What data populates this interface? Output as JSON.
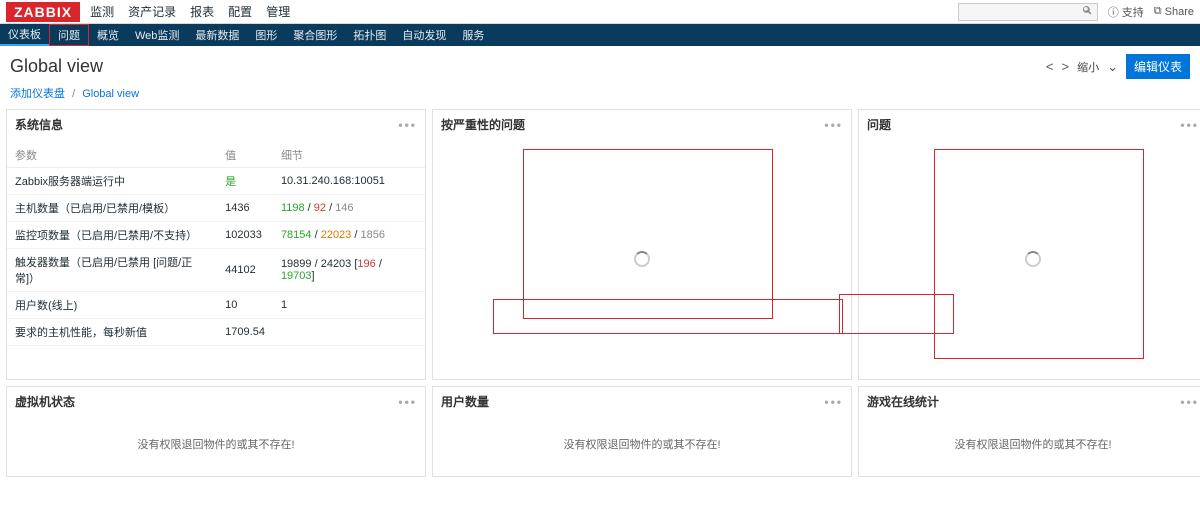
{
  "logo": "ZABBIX",
  "topmenu": [
    "监测",
    "资产记录",
    "报表",
    "配置",
    "管理"
  ],
  "support": "支持",
  "share": "Share",
  "subnav": [
    "仪表板",
    "问题",
    "概览",
    "Web监测",
    "最新数据",
    "图形",
    "聚合图形",
    "拓扑图",
    "自动发现",
    "服务"
  ],
  "page_title": "Global view",
  "edit_btn": "编辑仪表",
  "zoom_label": "缩小",
  "breadcrumb": {
    "a": "添加仪表盘",
    "b": "Global view"
  },
  "w_sysinfo": {
    "title": "系统信息",
    "cols": [
      "参数",
      "值",
      "细节"
    ],
    "rows": [
      {
        "p": "Zabbix服务器端运行中",
        "v_ok": "是",
        "d": "10.31.240.168:10051"
      },
      {
        "p": "主机数量（已启用/已禁用/模板）",
        "v": "1436",
        "d_parts": {
          "a_ok": "1198",
          "b_bad": "92",
          "c_muted": "146"
        }
      },
      {
        "p": "监控项数量（已启用/已禁用/不支持）",
        "v": "102033",
        "d_parts": {
          "a_ok": "78154",
          "b_warn": "22023",
          "c_muted": "1856"
        }
      },
      {
        "p": "触发器数量（已启用/已禁用 [问题/正常]）",
        "v": "44102",
        "d_trig": {
          "a": "19899",
          "b": "24203",
          "c_bad": "196",
          "d_ok": "19703"
        }
      },
      {
        "p": "用户数(线上)",
        "v": "10",
        "d": "1"
      },
      {
        "p": "要求的主机性能，每秒新值",
        "v": "1709.54",
        "d": ""
      }
    ]
  },
  "w_severity": {
    "title": "按严重性的问题"
  },
  "w_problems": {
    "title": "问题"
  },
  "w_vm": {
    "title": "虚拟机状态",
    "msg": "没有权限退回物件的或其不存在!"
  },
  "w_users": {
    "title": "用户数量",
    "msg": "没有权限退回物件的或其不存在!"
  },
  "w_game": {
    "title": "游戏在线统计",
    "msg": "没有权限退回物件的或其不存在!"
  }
}
